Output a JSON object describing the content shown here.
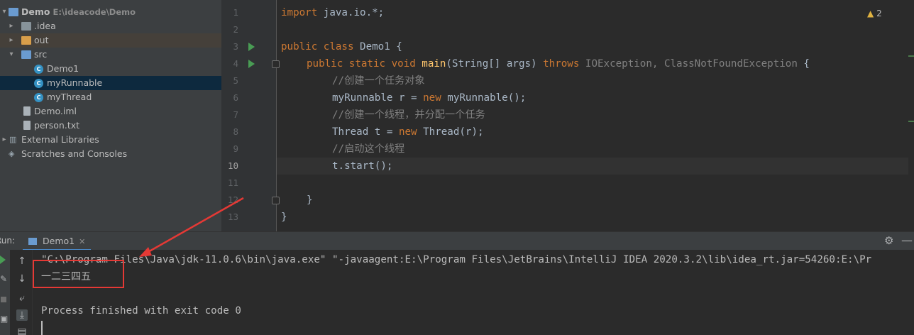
{
  "project": {
    "items": [
      {
        "label": "Demo",
        "path": "E:\\ideacode\\Demo",
        "icon": "module-folder-icon",
        "expanded": true
      },
      {
        "label": ".idea",
        "icon": "folder-icon",
        "expanded": false
      },
      {
        "label": "out",
        "icon": "folder-icon",
        "expanded": false
      },
      {
        "label": "src",
        "icon": "source-folder-icon",
        "expanded": true
      },
      {
        "label": "Demo1",
        "icon": "java-class-icon"
      },
      {
        "label": "myRunnable",
        "icon": "java-class-icon",
        "selected": true
      },
      {
        "label": "myThread",
        "icon": "java-class-icon"
      },
      {
        "label": "Demo.iml",
        "icon": "iml-file-icon"
      },
      {
        "label": "person.txt",
        "icon": "text-file-icon"
      },
      {
        "label": "External Libraries",
        "icon": "libraries-icon",
        "expanded": false
      },
      {
        "label": "Scratches and Consoles",
        "icon": "scratches-icon"
      }
    ]
  },
  "editor": {
    "line_numbers": [
      "1",
      "2",
      "3",
      "4",
      "5",
      "6",
      "7",
      "8",
      "9",
      "10",
      "11",
      "12",
      "13"
    ],
    "current_line": "10",
    "warnings": "2",
    "code": {
      "l1_kw": "import",
      "l1_rest": " java.io.*;",
      "l3_kw": "public class",
      "l3_rest": " Demo1 {",
      "l4_kw1": "public static void",
      "l4_fn": "main",
      "l4_mid": "(String[] args) ",
      "l4_kw2": "throws",
      "l4_ex": " IOException, ClassNotFoundException",
      "l4_end": " {",
      "l5": "//创建一个任务对象",
      "l6_a": "myRunnable r = ",
      "l6_kw": "new",
      "l6_b": " myRunnable();",
      "l7": "//创建一个线程，并分配一个任务",
      "l8_a": "Thread t = ",
      "l8_kw": "new",
      "l8_b": " Thread(r);",
      "l9": "//启动这个线程",
      "l10": "t.start();",
      "l12": "}",
      "l13": "}"
    }
  },
  "run": {
    "label": "Run:",
    "tab": "Demo1",
    "output": [
      "\"C:\\Program Files\\Java\\jdk-11.0.6\\bin\\java.exe\" \"-javaagent:E:\\Program Files\\JetBrains\\IntelliJ IDEA 2020.3.2\\lib\\idea_rt.jar=54260:E:\\Pr",
      "一二三四五",
      "",
      "Process finished with exit code 0"
    ]
  },
  "colors": {
    "annotation": "#e53935",
    "selection": "#0d293e",
    "keyword": "#cc7832"
  }
}
